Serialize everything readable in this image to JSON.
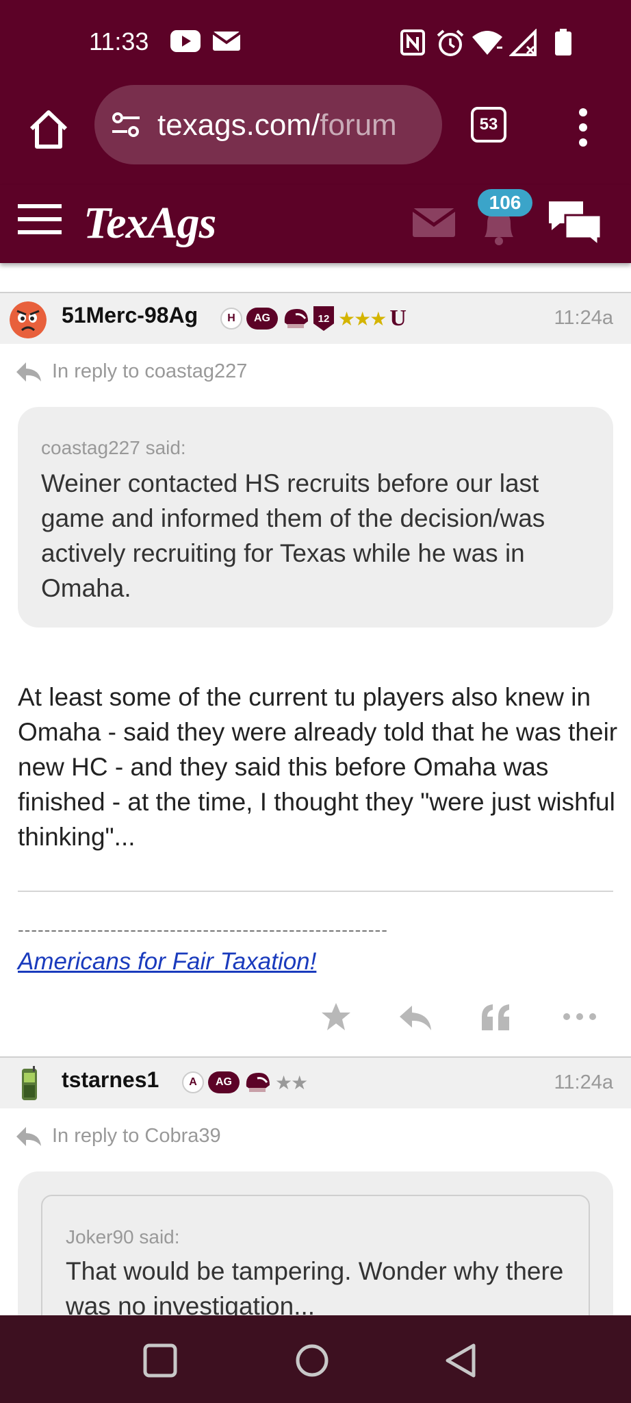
{
  "status_bar": {
    "time": "11:33",
    "icons": [
      "youtube-icon",
      "gmail-icon",
      "nfc-icon",
      "alarm-icon",
      "wifi-icon",
      "signal-icon",
      "battery-icon"
    ]
  },
  "browser": {
    "url_main": "texags.com/",
    "url_rest": "forum",
    "tab_count": "53"
  },
  "site": {
    "logo": "TexAgs",
    "notification_count": "106"
  },
  "posts": [
    {
      "username": "51Merc-98Ag",
      "time": "11:24a",
      "badge_h": "H",
      "badge_ag": "AG",
      "badge_12": "12",
      "stars": "★★★",
      "badge_u": "U",
      "reply_to": "In reply to coastag227",
      "quote_author": "coastag227 said:",
      "quote_text": "Weiner contacted HS recruits before our last game and informed them of the decision/was actively recruiting for Texas while he was in Omaha.",
      "body": "At least some of the current tu players also knew in Omaha - said they were already told that he was their new HC - and they said this before Omaha was finished - at the time, I thought they \"were just wishful thinking\"...",
      "signature_dashes": "--------------------------------------------------------",
      "signature_link": "Americans for Fair Taxation!"
    },
    {
      "username": "tstarnes1",
      "time": "11:24a",
      "badge_a": "A",
      "badge_ag": "AG",
      "stars": "★★",
      "reply_to": "In reply to Cobra39",
      "quote_author": "Joker90 said:",
      "quote_text": "That would be tampering. Wonder why there was no investigation..."
    }
  ],
  "colors": {
    "maroon": "#5c0227",
    "badge_blue": "#3ba4c9",
    "link_blue": "#1a3bbd",
    "star_gold": "#d4b400"
  }
}
